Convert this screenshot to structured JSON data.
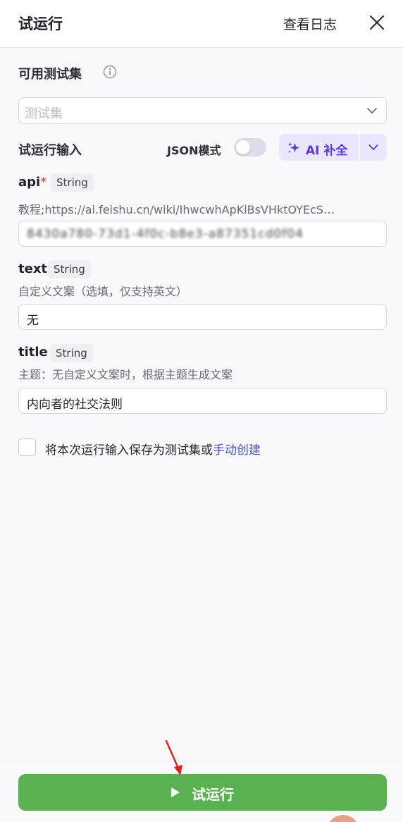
{
  "header": {
    "title": "试运行",
    "log_link": "查看日志"
  },
  "test_set": {
    "label": "可用测试集",
    "placeholder": "测试集"
  },
  "run_input": {
    "label": "试运行输入",
    "json_mode_label": "JSON模式",
    "json_mode_on": false,
    "ai_button_label": "AI 补全"
  },
  "fields": [
    {
      "name": "api",
      "required_mark": "*",
      "type": "String",
      "description": "教程;https://ai.feishu.cn/wiki/IhwcwhApKiBsVHktOYEcS…",
      "value": "8430a780-73d1-4f0c-b8e3-a87351cd0f04"
    },
    {
      "name": "text",
      "type": "String",
      "description": "自定义文案（选填，仅支持英文）",
      "value": "无"
    },
    {
      "name": "title",
      "type": "String",
      "description": "主题：无自定义文案时，根据主题生成文案",
      "value": "内向者的社交法则"
    }
  ],
  "save_option": {
    "text": "将本次运行输入保存为测试集或",
    "link": "手动创建",
    "checked": false
  },
  "run_button": {
    "label": "试运行"
  },
  "colors": {
    "accent_purple": "#5c35e6",
    "run_green": "#5ab14f",
    "link_blue": "#4752d6",
    "required_red": "#e0332e",
    "annotation_arrow": "#e0201c"
  }
}
